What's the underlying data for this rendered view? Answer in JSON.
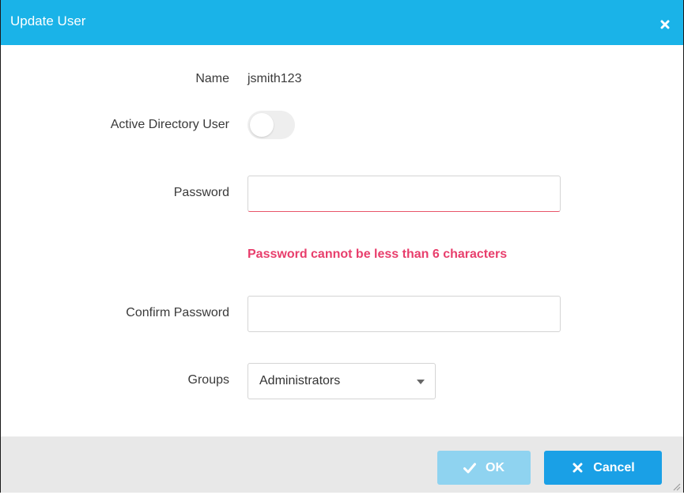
{
  "dialog": {
    "title": "Update User",
    "close_icon": "close-icon"
  },
  "form": {
    "name_label": "Name",
    "name_value": "jsmith123",
    "ad_user_label": "Active Directory User",
    "ad_user_enabled": false,
    "password_label": "Password",
    "password_value": "",
    "password_error": "Password cannot be less than 6 characters",
    "confirm_password_label": "Confirm Password",
    "confirm_password_value": "",
    "groups_label": "Groups",
    "groups_selected": "Administrators"
  },
  "footer": {
    "ok_label": "OK",
    "ok_icon": "check-icon",
    "cancel_label": "Cancel",
    "cancel_icon": "close-icon"
  },
  "colors": {
    "header": "#1ab3e8",
    "error": "#e83e6c",
    "ok_disabled": "#8fd3f0",
    "cancel": "#1aa0e6",
    "footer": "#e8e8e8"
  }
}
